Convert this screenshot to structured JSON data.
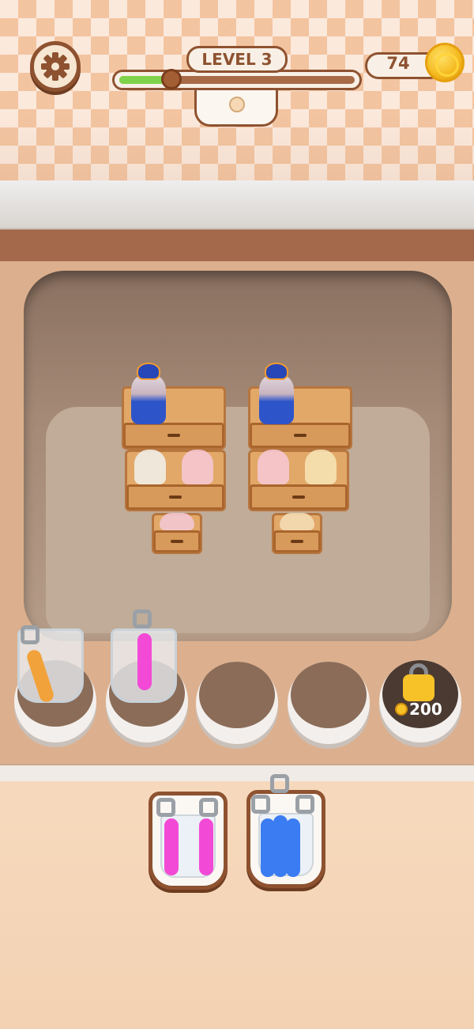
{
  "hud": {
    "level_label": "LEVEL 3",
    "level_progress": 0.22,
    "coins": "74"
  },
  "icons": {
    "settings": "gear-icon",
    "coin": "coin-icon",
    "lock": "lock-icon"
  },
  "slots": {
    "locked_price": "200"
  },
  "colors": {
    "opener_orange": "#f2a23a",
    "opener_pink": "#f24ad6",
    "opener_blue": "#3b7cf2",
    "progress_green": "#7fd34a",
    "frame_brown": "#8e5230"
  }
}
